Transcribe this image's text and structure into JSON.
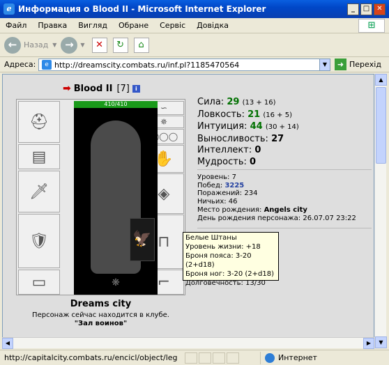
{
  "window": {
    "title": "Информация о Blood II - Microsoft Internet Explorer"
  },
  "menu": [
    "Файл",
    "Правка",
    "Вигляд",
    "Обране",
    "Сервіс",
    "Довідка"
  ],
  "toolbar": {
    "back_label": "Назад"
  },
  "address": {
    "label": "Адреса:",
    "url": "http://dreamscity.combats.ru/inf.pl?1185470564",
    "go_label": "Перехід"
  },
  "character": {
    "name": "Blood II",
    "level": "[7]",
    "hp": "410/410",
    "city": "Dreams city",
    "location_text": "Персонаж сейчас находится в клубе.",
    "club": "\"Зал воинов\""
  },
  "stats": [
    {
      "label": "Сила:",
      "value": "29",
      "extra": "(13 + 16)",
      "green": true
    },
    {
      "label": "Ловкость:",
      "value": "21",
      "extra": "(16 + 5)",
      "green": true
    },
    {
      "label": "Интуиция:",
      "value": "44",
      "extra": "(30 + 14)",
      "green": true
    },
    {
      "label": "Выносливость:",
      "value": "27",
      "extra": "",
      "green": false
    },
    {
      "label": "Интеллект:",
      "value": "0",
      "extra": "",
      "green": false
    },
    {
      "label": "Мудрость:",
      "value": "0",
      "extra": "",
      "green": false
    }
  ],
  "facts": {
    "level": "Уровень: 7",
    "wins_label": "Побед:",
    "wins": "3225",
    "losses": "Поражений: 234",
    "draws": "Ничьих: 46",
    "birthplace_label": "Место рождения:",
    "birthplace": "Angels city",
    "birthday": "День рождения персонажа: 26.07.07 23:22"
  },
  "tooltip": [
    "Белые Штаны",
    "Уровень жизни: +18",
    "Броня пояса: 3-20 (2+d18)",
    "Броня ног: 3-20 (2+d18)",
    "Долговечность: 13/30"
  ],
  "status": {
    "url": "http://capitalcity.combats.ru/encicl/object/leg",
    "zone": "Интернет"
  }
}
